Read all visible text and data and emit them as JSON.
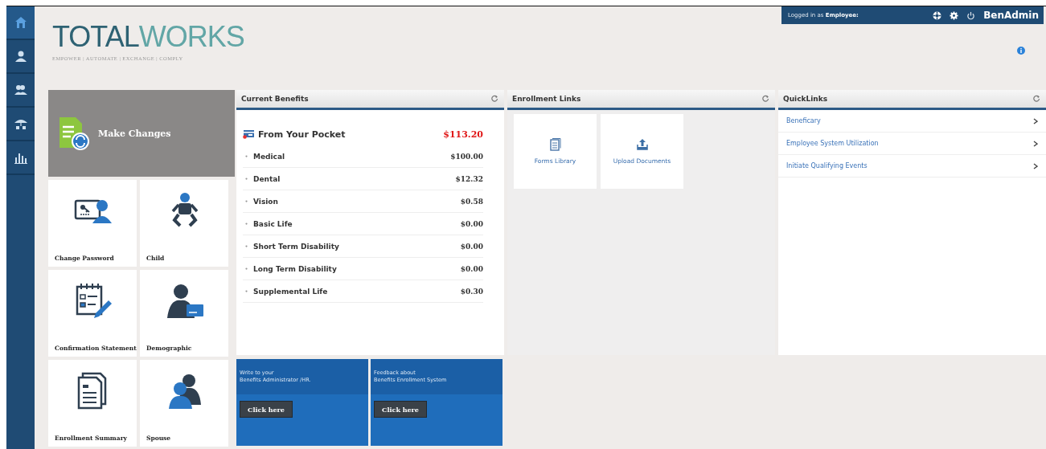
{
  "sidebar": {
    "items": [
      {
        "kind": "home",
        "selected": true
      },
      {
        "kind": "person",
        "selected": false
      },
      {
        "kind": "people",
        "selected": false
      },
      {
        "kind": "umbrella",
        "selected": false
      },
      {
        "kind": "chart",
        "selected": false
      }
    ]
  },
  "header": {
    "logo": {
      "name_dark": "TOTAL",
      "name_light": "WORKS",
      "tagline": "EMPOWER | AUTOMATE | EXCHANGE | COMPLY"
    },
    "login": "Logged in as **Employee:**",
    "user": "BenAdmin"
  },
  "make_changes": {
    "label": "Make Changes"
  },
  "tiles": [
    {
      "kind": "password",
      "label": "Change Password"
    },
    {
      "kind": "child",
      "label": "Child"
    },
    {
      "kind": "confirmation",
      "label": "Confirmation Statement"
    },
    {
      "kind": "demographic",
      "label": "Demographic"
    },
    {
      "kind": "summary",
      "label": "Enrollment Summary"
    },
    {
      "kind": "spouse",
      "label": "Spouse"
    }
  ],
  "current_benefits": {
    "title": "Current Benefits",
    "total": {
      "label": "From Your Pocket",
      "value": "$113.20"
    },
    "rows": [
      {
        "label": "Medical",
        "value": "$100.00"
      },
      {
        "label": "Dental",
        "value": "$12.32"
      },
      {
        "label": "Vision",
        "value": "$0.58"
      },
      {
        "label": "Basic Life",
        "value": "$0.00"
      },
      {
        "label": "Short Term Disability",
        "value": "$0.00"
      },
      {
        "label": "Long Term Disability",
        "value": "$0.00"
      },
      {
        "label": "Supplemental Life",
        "value": "$0.30"
      }
    ]
  },
  "enrollment_links": {
    "title": "Enrollment Links",
    "items": [
      {
        "kind": "forms",
        "label": "Forms Library"
      },
      {
        "kind": "upload",
        "label": "Upload Documents"
      }
    ]
  },
  "quicklinks": {
    "title": "QuickLinks",
    "items": [
      {
        "label": "Beneficary"
      },
      {
        "label": "Employee System Utilization"
      },
      {
        "label": "Initiate Qualifying Events"
      }
    ]
  },
  "promos": [
    {
      "text": "Write to your\nBenefits Administrator /HR.",
      "button": "Click here"
    },
    {
      "text": "Feedback about\nBenefits Enrollment System",
      "button": "Click here"
    }
  ]
}
